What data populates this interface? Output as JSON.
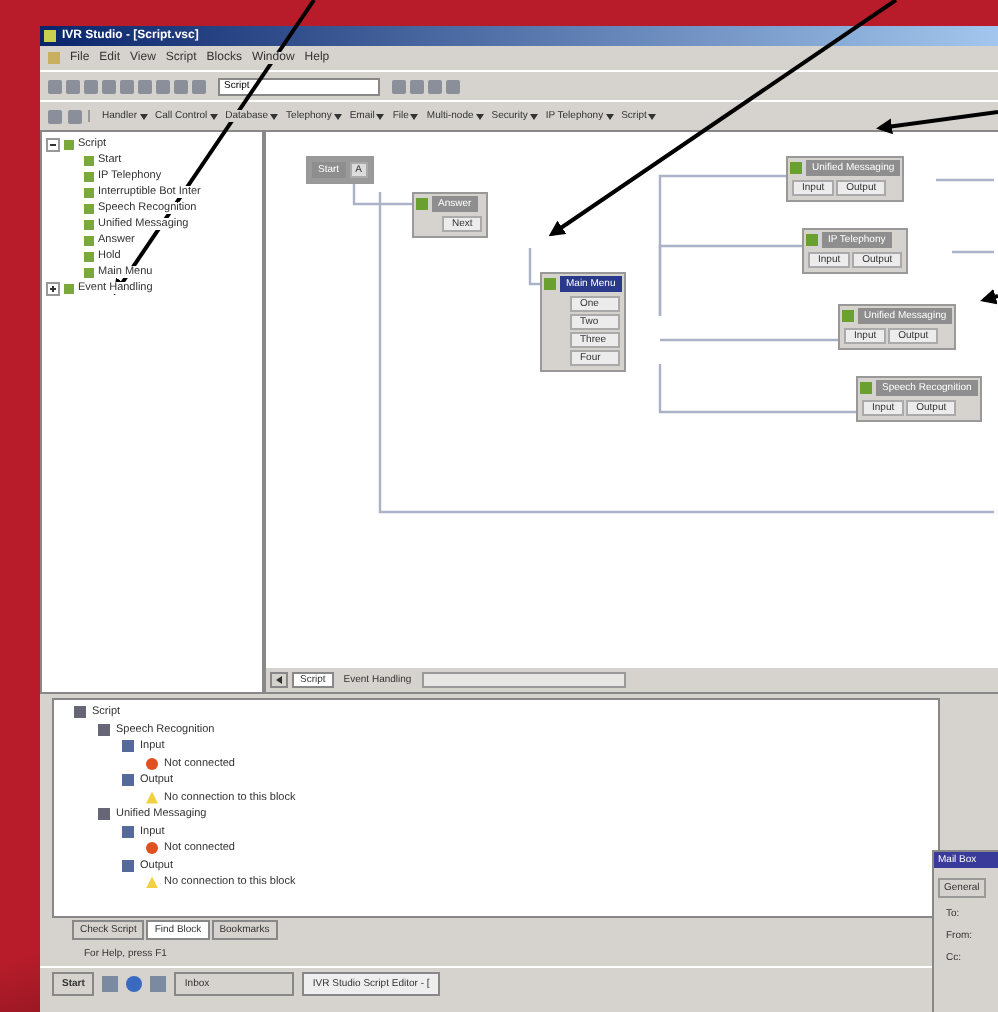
{
  "window": {
    "title": "IVR Studio - [Script.vsc]"
  },
  "menu": [
    "File",
    "Edit",
    "View",
    "Script",
    "Blocks",
    "Window",
    "Help"
  ],
  "toolbar": {
    "script_field": {
      "value": "Script"
    }
  },
  "block_categories": [
    "Handler",
    "Call Control",
    "Database",
    "Telephony",
    "Email",
    "File",
    "Multi-node",
    "Security",
    "IP Telephony",
    "Script"
  ],
  "tree": [
    {
      "label": "Script",
      "expanded": true,
      "children": [
        {
          "label": "Start"
        },
        {
          "label": "IP Telephony"
        },
        {
          "label": "Interruptible Bot Inter"
        },
        {
          "label": "Speech Recognition"
        },
        {
          "label": "Unified Messaging"
        },
        {
          "label": "Answer"
        },
        {
          "label": "Hold"
        },
        {
          "label": "Main Menu"
        }
      ]
    },
    {
      "label": "Event Handling",
      "expanded": false
    }
  ],
  "diagram": {
    "nodes": [
      {
        "kind": "start",
        "title": "Start",
        "ports": [
          "A"
        ]
      },
      {
        "kind": "block",
        "title": "Answer",
        "ports": [
          "Next"
        ]
      },
      {
        "kind": "menu",
        "title": "Main Menu",
        "ports": [
          "One",
          "Two",
          "Three",
          "Four"
        ]
      },
      {
        "kind": "io",
        "title": "Unified Messaging",
        "ports": [
          "Input",
          "Output"
        ]
      },
      {
        "kind": "io",
        "title": "IP Telephony",
        "ports": [
          "Input",
          "Output"
        ]
      },
      {
        "kind": "io",
        "title": "Unified Messaging",
        "ports": [
          "Input",
          "Output"
        ]
      },
      {
        "kind": "io",
        "title": "Speech Recognition",
        "ports": [
          "Input",
          "Output"
        ]
      }
    ]
  },
  "editor_tabs": [
    {
      "label": "Script",
      "selected": true
    },
    {
      "label": "Event Handling",
      "selected": false
    }
  ],
  "check_tree": [
    {
      "label": "Script",
      "kind": "script",
      "children": [
        {
          "label": "Speech Recognition",
          "kind": "block",
          "children": [
            {
              "label": "Input",
              "kind": "port",
              "children": [
                {
                  "label": "Not connected",
                  "kind": "error"
                }
              ]
            },
            {
              "label": "Output",
              "kind": "port",
              "children": [
                {
                  "label": "No connection to this block",
                  "kind": "warning"
                }
              ]
            }
          ]
        },
        {
          "label": "Unified Messaging",
          "kind": "block",
          "children": [
            {
              "label": "Input",
              "kind": "port",
              "children": [
                {
                  "label": "Not connected",
                  "kind": "error"
                }
              ]
            },
            {
              "label": "Output",
              "kind": "port",
              "children": [
                {
                  "label": "No connection to this block",
                  "kind": "warning"
                }
              ]
            }
          ]
        }
      ]
    }
  ],
  "bottom_tabs": [
    {
      "label": "Check Script",
      "selected": false
    },
    {
      "label": "Find Block",
      "selected": true
    },
    {
      "label": "Bookmarks",
      "selected": false
    }
  ],
  "status_bar": "For Help, press F1",
  "dialog": {
    "title": "Mail Box",
    "tab": "General",
    "fields": [
      "To:",
      "From:",
      "Cc:"
    ]
  },
  "taskbar": {
    "start": "Start",
    "items": [
      {
        "label": "Inbox",
        "selected": false
      },
      {
        "label": "IVR Studio Script Editor - [",
        "selected": true
      }
    ]
  }
}
